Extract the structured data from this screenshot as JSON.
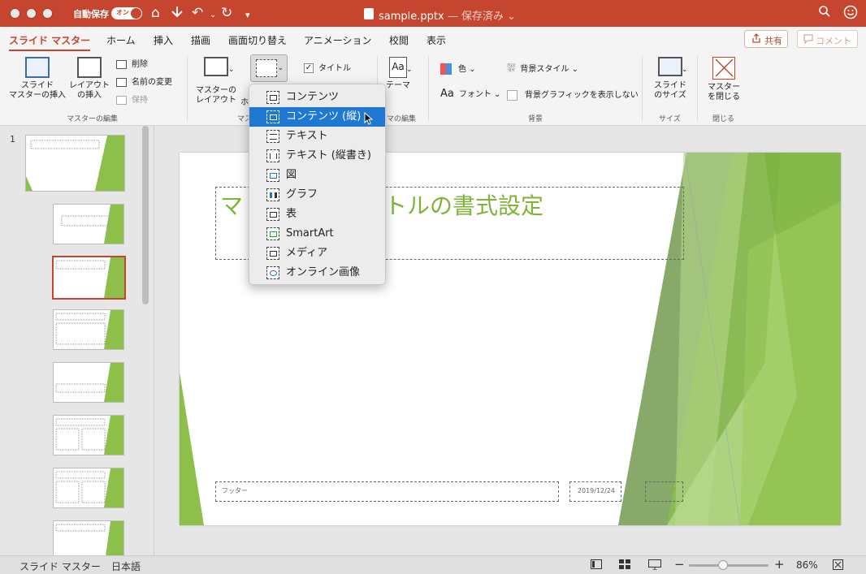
{
  "titlebar": {
    "autosave_label": "自動保存",
    "autosave_state": "オン",
    "filename": "sample.pptx",
    "save_status": " — 保存済み ⌄"
  },
  "tabs": [
    {
      "label": "スライド マスター",
      "active": true
    },
    {
      "label": "ホーム"
    },
    {
      "label": "挿入"
    },
    {
      "label": "描画"
    },
    {
      "label": "画面切り替え"
    },
    {
      "label": "アニメーション"
    },
    {
      "label": "校閲"
    },
    {
      "label": "表示"
    }
  ],
  "share_label": "共有",
  "comment_label": "コメント",
  "ribbon": {
    "insert_master": "スライド\nマスターの挿入",
    "insert_layout": "レイアウト\nの挿入",
    "delete": "削除",
    "rename": "名前の変更",
    "preserve": "保持",
    "group_master_edit": "マスターの編集",
    "master_layout": "マスターの\nレイアウト",
    "placeholder_partial": "ホ",
    "group_layout_partial": "マス",
    "title_check": "タイトル",
    "theme": "テーマ",
    "group_theme_partial": "マの編集",
    "colors": "色",
    "fonts": "フォント",
    "bg_style": "背景スタイル",
    "hide_bg": "背景グラフィックを表示しない",
    "group_background": "背景",
    "slide_size": "スライド\nのサイズ",
    "group_size": "サイズ",
    "close_master": "マスター\nを閉じる",
    "group_close": "閉じる"
  },
  "slide": {
    "title_left": "マ",
    "title_right": "トルの書式設定",
    "footer": "フッター",
    "date": "2019/12/24",
    "page_number": "#"
  },
  "thumbnail_number": "1",
  "menu_items": [
    {
      "label": "コンテンツ",
      "icon": "content-icon"
    },
    {
      "label": "コンテンツ (縦)",
      "icon": "content-vertical-icon",
      "highlighted": true
    },
    {
      "label": "テキスト",
      "icon": "text-icon"
    },
    {
      "label": "テキスト (縦書き)",
      "icon": "text-vertical-icon"
    },
    {
      "label": "図",
      "icon": "picture-icon"
    },
    {
      "label": "グラフ",
      "icon": "chart-icon"
    },
    {
      "label": "表",
      "icon": "table-icon"
    },
    {
      "label": "SmartArt",
      "icon": "smartart-icon"
    },
    {
      "label": "メディア",
      "icon": "media-icon"
    },
    {
      "label": "オンライン画像",
      "icon": "online-picture-icon"
    }
  ],
  "status": {
    "view": "スライド マスター",
    "language": "日本語",
    "zoom": "86%",
    "zoom_level": 0.43
  },
  "colors": {
    "accent": "#c6452e",
    "highlight": "#1f78d1",
    "green": "#7fb439"
  }
}
